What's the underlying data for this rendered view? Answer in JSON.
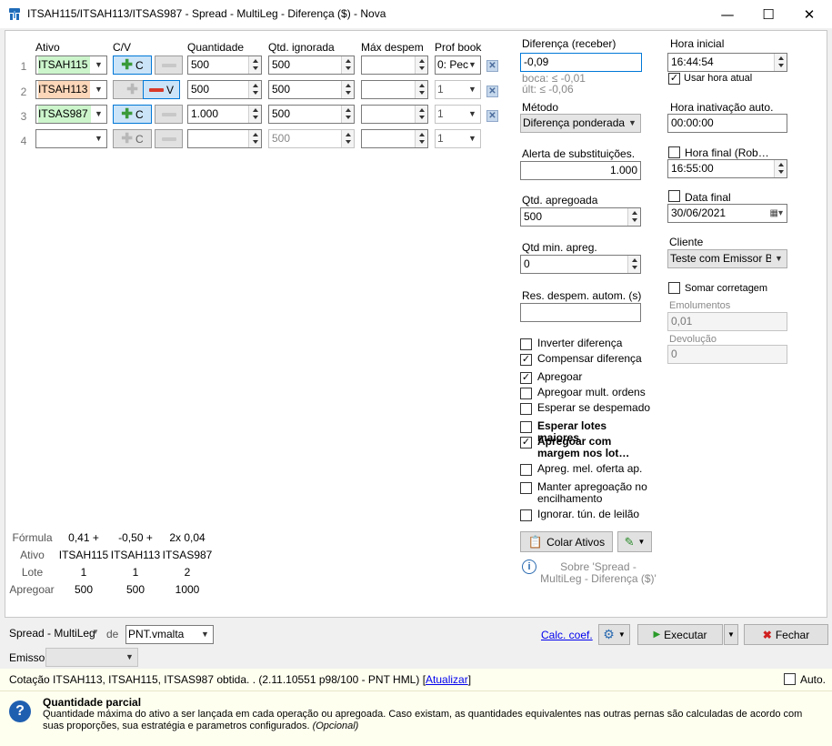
{
  "window": {
    "title": "ITSAH115/ITSAH113/ITSAS987 - Spread - MultiLeg - Diferença ($) - Nova",
    "minimize": "—",
    "maximize": "☐",
    "close": "✕"
  },
  "grid": {
    "headers": {
      "ativo": "Ativo",
      "cv": "C/V",
      "quantidade": "Quantidade",
      "qtd_ignorada": "Qtd. ignorada",
      "max_despem": "Máx despem",
      "prof_book": "Prof book"
    },
    "rows": [
      {
        "num": "1",
        "ativo": "ITSAH115",
        "side": "C",
        "qty": "500",
        "ignored": "500",
        "max": "",
        "book": "0: Pec"
      },
      {
        "num": "2",
        "ativo": "ITSAH113",
        "side": "V",
        "qty": "500",
        "ignored": "500",
        "max": "",
        "book": "1"
      },
      {
        "num": "3",
        "ativo": "ITSAS987",
        "side": "C",
        "qty": "1.000",
        "ignored": "500",
        "max": "",
        "book": "1"
      },
      {
        "num": "4",
        "ativo": "",
        "side": "C",
        "qty": "",
        "ignored": "500",
        "max": "",
        "book": "1"
      }
    ],
    "buy_label": "C",
    "sell_label": "V"
  },
  "formula": {
    "labels": {
      "formula": "Fórmula",
      "ativo": "Ativo",
      "lote": "Lote",
      "apregoar": "Apregoar"
    },
    "cols": [
      {
        "formula": "0,41 +",
        "ativo": "ITSAH115",
        "lote": "1",
        "apregoar": "500"
      },
      {
        "formula": "-0,50 +",
        "ativo": "ITSAH113",
        "lote": "1",
        "apregoar": "500"
      },
      {
        "formula": "2x 0,04",
        "ativo": "ITSAS987",
        "lote": "2",
        "apregoar": "1000"
      }
    ]
  },
  "params": {
    "diferenca_label": "Diferença (receber)",
    "diferenca_value": "-0,09",
    "boca": "boca: ≤ -0,01",
    "ult": "últ: ≤ -0,06",
    "metodo_label": "Método",
    "metodo_value": "Diferença ponderada",
    "alerta_label": "Alerta de substituições.",
    "alerta_value": "1.000",
    "qtd_apregoada_label": "Qtd. apregoada",
    "qtd_apregoada_value": "500",
    "qtd_min_label": "Qtd min. apreg.",
    "qtd_min_value": "0",
    "res_label": "Res. despem. autom. (s)",
    "res_value": "",
    "checks": [
      {
        "label": "Inverter diferença",
        "checked": false,
        "bold": false
      },
      {
        "label": "Compensar diferença",
        "checked": true,
        "bold": false
      },
      {
        "label": "Apregoar",
        "checked": true,
        "bold": false
      },
      {
        "label": "Apregoar mult. ordens",
        "checked": false,
        "bold": false
      },
      {
        "label": "Esperar se despemado",
        "checked": false,
        "bold": false
      },
      {
        "label": "Esperar lotes maiores",
        "checked": false,
        "bold": true
      },
      {
        "label": "Apregoar com margem nos lot…",
        "checked": true,
        "bold": true
      },
      {
        "label": "Apreg. mel. oferta ap.",
        "checked": false,
        "bold": false
      },
      {
        "label": "Manter apregoação no encilhamento",
        "checked": false,
        "bold": false
      },
      {
        "label": "Ignorar. tún. de leilão",
        "checked": false,
        "bold": false
      }
    ],
    "colar_label": "Colar Ativos",
    "sobre_label": "Sobre 'Spread - MultiLeg - Diferença ($)'"
  },
  "time": {
    "hora_inicial_label": "Hora inicial",
    "hora_inicial_value": "16:44:54",
    "usar_hora_atual": "Usar hora atual",
    "hora_inativacao_label": "Hora inativação auto.",
    "hora_inativacao_value": "00:00:00",
    "hora_final_label": "Hora final (Rob…",
    "hora_final_value": "16:55:00",
    "data_final_label": "Data final",
    "data_final_value": "30/06/2021",
    "cliente_label": "Cliente",
    "cliente_value": "Teste com Emissor BVS",
    "somar_label": "Somar corretagem",
    "emolumentos_label": "Emolumentos",
    "emolumentos_value": "0,01",
    "devolucao_label": "Devolução",
    "devolucao_value": "0"
  },
  "bottom": {
    "strategy": "Spread - MultiLeg",
    "de": "de",
    "account": "PNT.vmalta",
    "calc": "Calc. coef.",
    "executar": "Executar",
    "fechar": "Fechar",
    "emissor_label": "Emissor",
    "emissor_value": ""
  },
  "status": {
    "text": "Cotação ITSAH113, ITSAH115, ITSAS987 obtida. .  (2.11.10551 p98/100 - PNT HML) [",
    "link": "Atualizar",
    "end": "]",
    "auto": "Auto."
  },
  "help": {
    "title": "Quantidade parcial",
    "body": "Quantidade máxima do ativo a ser lançada em cada operação ou apregoada. Caso existam, as quantidades equivalentes nas outras pernas são calculadas de acordo com suas proporções, sua estratégia e parametros configurados.",
    "optional": "(Opcional)"
  }
}
